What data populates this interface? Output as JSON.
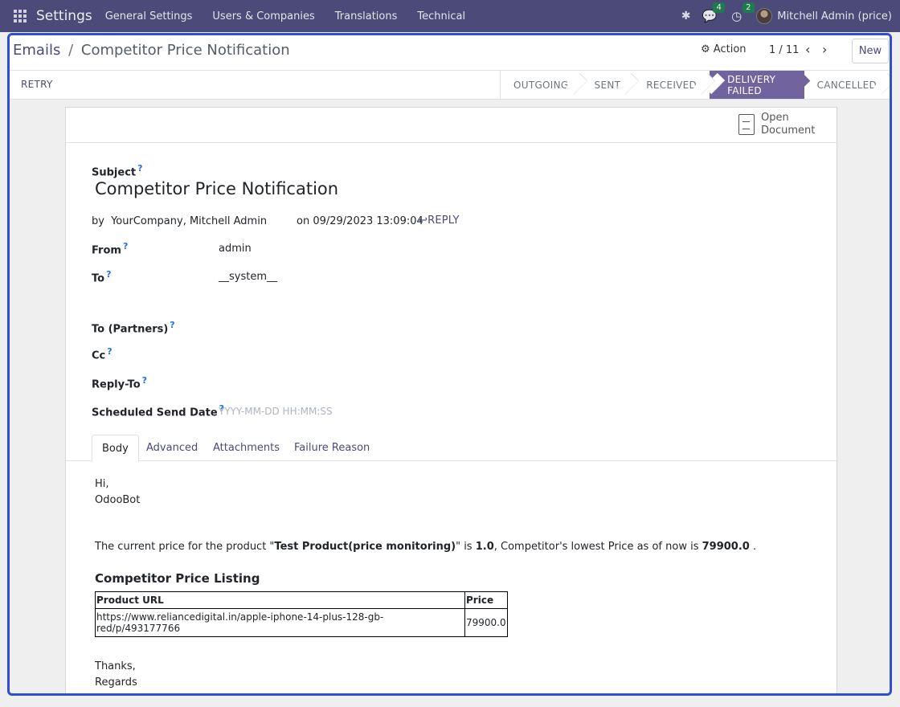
{
  "navbar": {
    "brand": "Settings",
    "menu": [
      "General Settings",
      "Users & Companies",
      "Translations",
      "Technical"
    ],
    "messages_count": "4",
    "activities_count": "2",
    "user_name": "Mitchell Admin (price)"
  },
  "breadcrumb": {
    "parent": "Emails",
    "separator": "/",
    "current": "Competitor Price Notification"
  },
  "control": {
    "action_label": "Action",
    "pager": "1 / 11",
    "new_label": "New"
  },
  "status": {
    "retry_label": "RETRY",
    "stages": [
      "OUTGOING",
      "SENT",
      "RECEIVED",
      "DELIVERY FAILED",
      "CANCELLED"
    ],
    "active_stage": "DELIVERY FAILED"
  },
  "button_box": {
    "open_document_label": "Open Document"
  },
  "form": {
    "subject_label": "Subject",
    "subject": "Competitor Price Notification",
    "by_prefix": "by",
    "author": "YourCompany, Mitchell Admin",
    "date_text": "on 09/29/2023 13:09:04",
    "reply_label": "REPLY",
    "from_label": "From",
    "from_value": "admin",
    "to_label": "To",
    "to_value": "__system__",
    "to_partners_label": "To (Partners)",
    "cc_label": "Cc",
    "reply_to_label": "Reply-To",
    "scheduled_label": "Scheduled Send Date",
    "scheduled_placeholder": "YYYY-MM-DD HH:MM:SS",
    "help_mark": "?"
  },
  "tabs": [
    "Body",
    "Advanced",
    "Attachments",
    "Failure Reason"
  ],
  "body": {
    "greeting": "Hi,",
    "sender": "OdooBot",
    "msg_part1": "The current price for the product \"",
    "product": "Test Product(price monitoring)",
    "msg_part2": "\" is ",
    "current_price": "1.0",
    "msg_part3": ", Competitor's lowest Price as of now is ",
    "lowest_price": "79900.0",
    "msg_part4": " .",
    "listing_title": "Competitor Price Listing",
    "table_headers": [
      "Product URL",
      "Price"
    ],
    "table_rows": [
      [
        "https://www.reliancedigital.in/apple-iphone-14-plus-128-gb-red/p/493177766",
        "79900.0"
      ]
    ],
    "closing1": "Thanks,",
    "closing2": "Regards"
  },
  "colors": {
    "navbar": "#4b4a78",
    "accent": "#71639e",
    "focus_frame": "#2e4ed4"
  }
}
